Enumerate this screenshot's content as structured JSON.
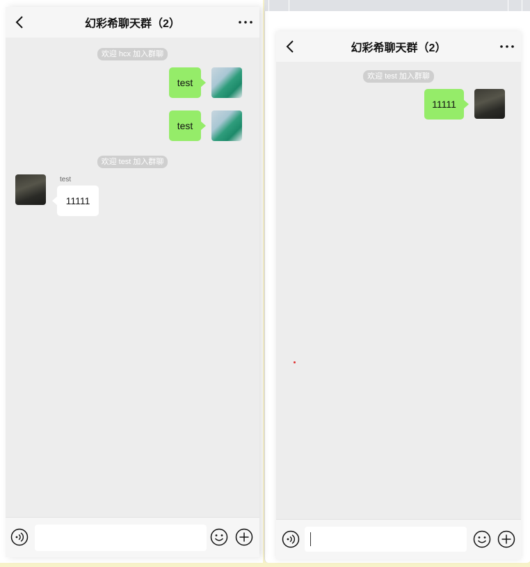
{
  "left_chat": {
    "title": "幻彩希聊天群（2）",
    "notices": [
      "欢迎 hcx 加入群聊",
      "欢迎 test 加入群聊"
    ],
    "messages": [
      {
        "text": "test",
        "from": "self"
      },
      {
        "text": "test",
        "from": "self"
      },
      {
        "sender": "test",
        "text": "11111",
        "from": "other"
      }
    ],
    "input_value": ""
  },
  "right_chat": {
    "title": "幻彩希聊天群（2）",
    "notices": [
      "欢迎 test 加入群聊"
    ],
    "messages": [
      {
        "text": "11111",
        "from": "self"
      }
    ],
    "input_value": ""
  },
  "icons": {
    "back": "chevron-left-icon",
    "more": "more-dots-icon",
    "voice": "voice-icon",
    "emoji": "emoji-icon",
    "plus": "plus-icon"
  },
  "colors": {
    "self_bubble": "#95ec69",
    "other_bubble": "#ffffff",
    "chat_background": "#ededed",
    "header_background": "#f6f6f6",
    "notice_background": "#cfcfcf"
  }
}
